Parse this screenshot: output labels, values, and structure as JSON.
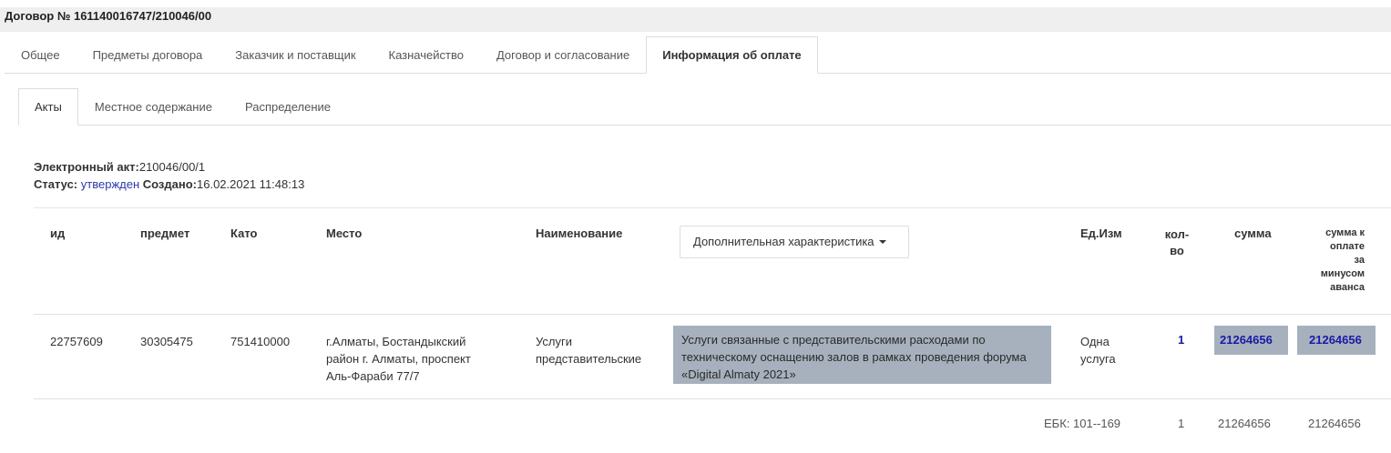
{
  "title": "Договор № 161140016747/210046/00",
  "main_tabs": [
    "Общее",
    "Предметы договора",
    "Заказчик и поставщик",
    "Казначейство",
    "Договор и согласование",
    "Информация об оплате"
  ],
  "sub_tabs": [
    "Акты",
    "Местное содержание",
    "Распределение"
  ],
  "act": {
    "label": "Электронный акт:",
    "value": "210046/00/1",
    "status_label": "Статус:",
    "status_value": "утвержден",
    "created_label": "Создано:",
    "created_value": "16.02.2021 11:48:13"
  },
  "headers": {
    "id": "ид",
    "subject": "предмет",
    "kato": "Като",
    "place": "Место",
    "name": "Наименование",
    "extra": "Дополнительная характеристика",
    "unit": "Ед.Изм",
    "qty_line1": "кол-",
    "qty_line2": "во",
    "sum": "сумма",
    "net_line1": "сумма к",
    "net_line2": "оплате",
    "net_line3": "за",
    "net_line4": "минусом",
    "net_line5": "аванса"
  },
  "row": {
    "id": "22757609",
    "subject": "30305475",
    "kato": "751410000",
    "place_line1": "г.Алматы, Бостандыкский",
    "place_line2": "район г. Алматы, проспект",
    "place_line3": "Аль-Фараби 77/7",
    "name_line1": "Услуги",
    "name_line2": "представительские",
    "desc_line1": "Услуги связанные с представительскими расходами по",
    "desc_line2": "техническому оснащению залов в рамках проведения форума",
    "desc_line3": "«Digital Almaty 2021»",
    "unit_line1": "Одна",
    "unit_line2": "услуга",
    "qty": "1",
    "sum": "21264656",
    "net": "21264656"
  },
  "totals": {
    "ebk": "ЕБК: 101--169",
    "qty": "1",
    "sum": "21264656",
    "net": "21264656"
  },
  "colors": {
    "highlight": "#a6b1bd",
    "link": "#1a1aa6",
    "status": "#2b3aa8"
  }
}
